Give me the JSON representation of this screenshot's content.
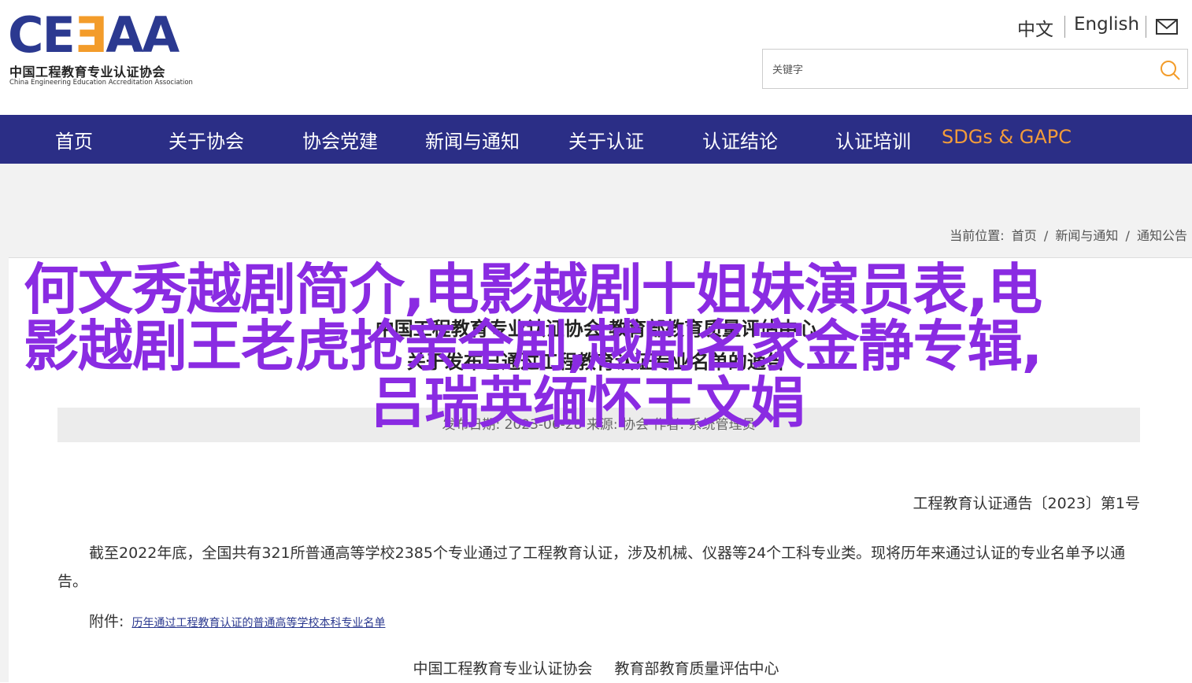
{
  "logo": {
    "mark_part1": "CE",
    "mark_part2": "Ǝ",
    "mark_part3": "AA",
    "name_cn": "中国工程教育专业认证协会",
    "name_en": "China Engineering Education Accreditation Association"
  },
  "header": {
    "lang_zh": "中文",
    "lang_en": "English",
    "mail_icon": "mail-icon"
  },
  "search": {
    "placeholder": "关键字",
    "icon": "search-icon",
    "icon_color": "#f39c2a"
  },
  "nav": {
    "items": [
      {
        "label": "首页"
      },
      {
        "label": "关于协会"
      },
      {
        "label": "协会党建"
      },
      {
        "label": "新闻与通知"
      },
      {
        "label": "关于认证"
      },
      {
        "label": "认证结论"
      },
      {
        "label": "认证培训"
      },
      {
        "label": "SDGs & GAPC"
      }
    ],
    "background": "#2b2e86",
    "accent": "#f39c3a"
  },
  "breadcrumb": {
    "prefix": "当前位置:",
    "items": [
      "首页",
      "新闻与通知",
      "通知公告"
    ],
    "separator": "/"
  },
  "article": {
    "title_line1": "中国工程教育专业认证协会 教育部教育质量评估中心",
    "title_line2": "关于发布已通过工程教育认证专业名单的通告",
    "meta": "发布日期: 2023-06-28  来源: 协会  作者: 系统管理员",
    "notice_no": "工程教育认证通告〔2023〕第1号",
    "paragraph": "截至2022年底，全国共有321所普通高等学校2385个专业通过了工程教育认证，涉及机械、仪器等24个工科专业类。现将历年来通过认证的专业名单予以通告。",
    "attach_label": "附件:",
    "attach_link": "历年通过工程教育认证的普通高等学校本科专业名单",
    "sign_org1": "中国工程教育专业认证协会",
    "sign_org2": "教育部教育质量评估中心"
  },
  "overlay": {
    "line1": "何文秀越剧简介,电影越剧十姐妹演员表,电",
    "line2": "影越剧王老虎抢亲全剧,越剧名家金静专辑,",
    "line3": "吕瑞英缅怀王文娟",
    "color": "#8a2be2"
  }
}
